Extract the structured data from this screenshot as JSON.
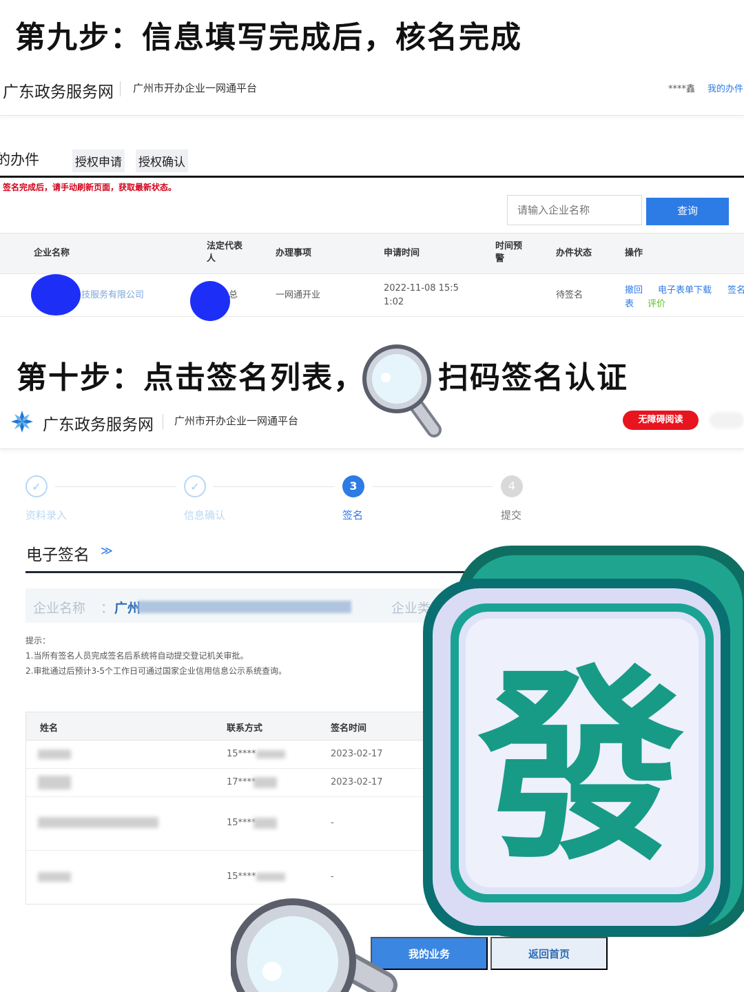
{
  "step9": {
    "title": "第九步：信息填写完成后，核名完成",
    "header": {
      "site_name": "广东政务服务网",
      "platform": "广州市开办企业一网通平台",
      "user": "****鑫",
      "my_affairs": "我的办件"
    },
    "tabs": {
      "current": "的办件",
      "auth_apply": "授权申请",
      "auth_confirm": "授权确认"
    },
    "notice": "签名完成后，请手动刷新页面，获取最新状态。",
    "search": {
      "placeholder": "请输入企业名称",
      "button": "查询"
    },
    "table": {
      "headers": {
        "company": "企业名称",
        "legal_rep_line1": "法定代表",
        "legal_rep_line2": "人",
        "matter": "办理事项",
        "apply_time": "申请时间",
        "warning_line1": "时间预",
        "warning_line2": "警",
        "status": "办件状态",
        "action": "操作"
      },
      "row": {
        "company": "技服务有限公司",
        "legal_rep": "总",
        "matter": "一网通开业",
        "apply_time_line1": "2022-11-08 15:5",
        "apply_time_line2": "1:02",
        "status": "待签名",
        "actions": {
          "revoke": "撤回",
          "download": "电子表单下载",
          "sign": "签名",
          "list": "表",
          "evaluate": "评价"
        }
      }
    }
  },
  "step10": {
    "title_part1": "第十步：点击签名列表，",
    "title_part2": "扫码签名认证",
    "header": {
      "site_name": "广东政务服务网",
      "platform": "广州市开办企业一网通平台",
      "accessibility": "无障碍阅读"
    },
    "steps": [
      {
        "label": "资料录入",
        "state": "done",
        "number": ""
      },
      {
        "label": "信息确认",
        "state": "done",
        "number": ""
      },
      {
        "label": "签名",
        "state": "active",
        "number": "3"
      },
      {
        "label": "提交",
        "state": "todo",
        "number": "4"
      }
    ],
    "section_title": "电子签名",
    "company_name_label": "企业名称",
    "company_name_colon": "：",
    "company_name_value": "广州",
    "company_type_label": "企业类",
    "tips": {
      "heading": "提示：",
      "line1": "1.当所有签名人员完成签名后系统将自动提交登记机关审批。",
      "line2": "2.审批通过后预计3-5个工作日可通过国家企业信用信息公示系统查询。"
    },
    "signers": {
      "headers": {
        "name": "姓名",
        "contact": "联系方式",
        "time": "签名时间"
      },
      "rows": [
        {
          "contact": "15****",
          "time": "2023-02-17"
        },
        {
          "contact": "17****",
          "time": "2023-02-17"
        },
        {
          "contact": "15****",
          "time": "-"
        },
        {
          "contact": "15****",
          "time": "-"
        }
      ]
    },
    "buttons": {
      "my_business": "我的业务",
      "back_home": "返回首页"
    }
  },
  "overlay": {
    "mahjong_tile_character": "發",
    "tile_color": "#1a9e8a"
  },
  "colors": {
    "accent_blue": "#2d7be5",
    "warning_red": "#d0021b",
    "access_red": "#e8141e"
  }
}
